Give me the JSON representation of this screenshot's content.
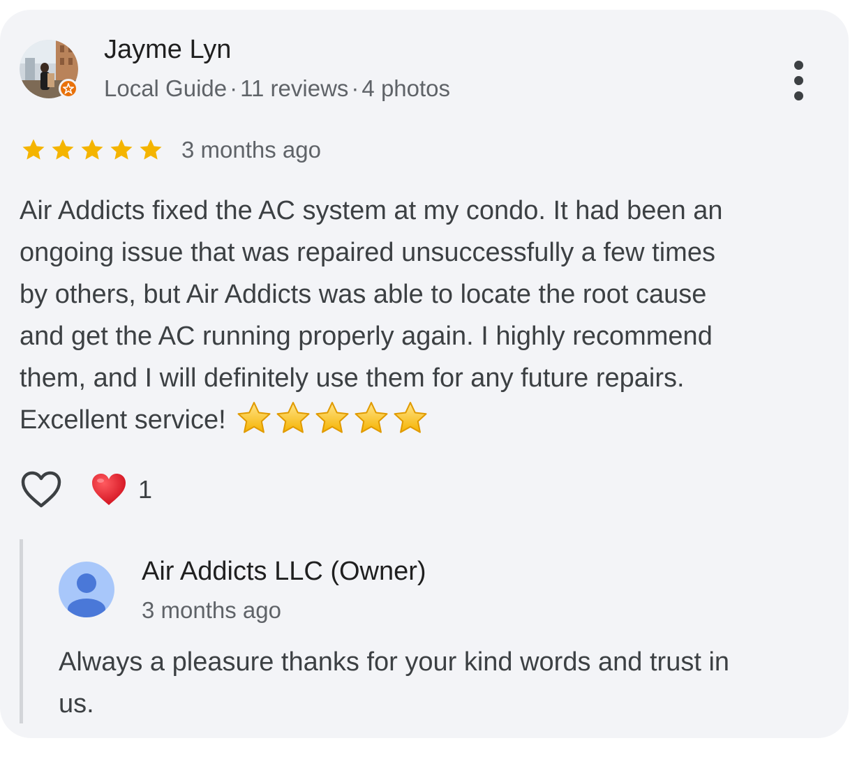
{
  "review": {
    "author": {
      "name": "Jayme Lyn",
      "badge": "Local Guide",
      "reviews_count": "11 reviews",
      "photos_count": "4 photos",
      "separator": "·"
    },
    "rating": 5,
    "star_color": "#f4b400",
    "date": "3 months ago",
    "text_lines": [
      "Air Addicts fixed the AC system at my condo. It had been an",
      "ongoing issue that was repaired unsuccessfully a few times",
      "by others, but Air Addicts was able to locate the root cause",
      "and get the AC running properly again. I highly recommend",
      "them, and I will definitely use them for any future repairs.",
      "Excellent service!"
    ],
    "text_emoji": "⭐⭐⭐⭐⭐",
    "reactions": {
      "like_icon": "heart-outline-icon",
      "reaction_icon": "red-heart-icon",
      "count": "1"
    }
  },
  "owner_reply": {
    "name": "Air Addicts LLC (Owner)",
    "date": "3 months ago",
    "text_lines": [
      "Always a pleasure thanks for your kind words and trust in",
      "us."
    ]
  },
  "colors": {
    "card_background": "#f3f4f7",
    "guide_badge": "#e8710a",
    "owner_avatar_bg": "#a8c7fa",
    "owner_avatar_fg": "#4a78d8",
    "reaction_heart": "#e0202e"
  }
}
